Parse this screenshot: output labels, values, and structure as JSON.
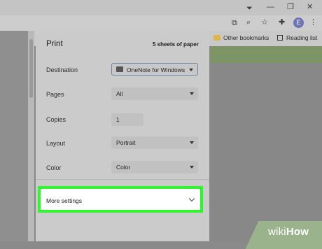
{
  "chrome": {
    "window_controls": [
      "minimize",
      "restore",
      "close"
    ],
    "toolbar_icons": [
      "open-in-app-icon",
      "zoom-icon",
      "star-icon",
      "extensions-icon",
      "profile-avatar",
      "menu-icon"
    ],
    "avatar_letter": "E",
    "bookmarks": {
      "other": "Other bookmarks",
      "reading_list": "Reading list"
    }
  },
  "print": {
    "title": "Print",
    "sheets": "5 sheets of paper",
    "destination": {
      "label": "Destination",
      "value": "OneNote for Windows"
    },
    "pages": {
      "label": "Pages",
      "value": "All"
    },
    "copies": {
      "label": "Copies",
      "value": "1"
    },
    "layout": {
      "label": "Layout",
      "value": "Portrait"
    },
    "color": {
      "label": "Color",
      "value": "Color"
    },
    "more_settings": "More settings",
    "highlight_color": "#2ef52e"
  },
  "watermark": {
    "wiki": "wiki",
    "how": "How"
  }
}
